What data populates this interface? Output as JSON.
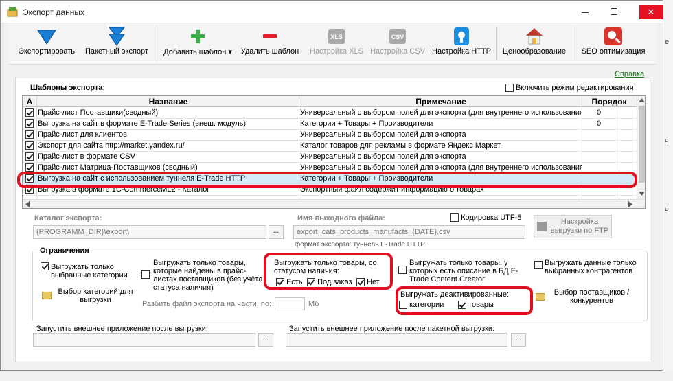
{
  "window": {
    "title": "Экспорт данных",
    "close_glyph": "✕"
  },
  "toolbar": {
    "export": "Экспортировать",
    "batch_export": "Пакетный экспорт",
    "add_template": "Добавить шаблон ▾",
    "delete_template": "Удалить шаблон",
    "xls_settings": "Настройка XLS",
    "csv_settings": "Настройка CSV",
    "http_settings": "Настройка HTTP",
    "pricing": "Ценообразование",
    "seo": "SEO оптимизация",
    "xls_badge": "XLS",
    "csv_badge": "CSV"
  },
  "help_link": "Справка",
  "templates": {
    "section_title": "Шаблоны экспорта:",
    "edit_mode_label": "Включить режим редактирования",
    "columns": {
      "a": "А",
      "name": "Название",
      "note": "Примечание",
      "order": "Порядок"
    },
    "rows": [
      {
        "checked": true,
        "name": "Прайс-лист Поставщики(сводный)",
        "note": "Универсальный с выбором полей для экспорта (для внутреннего использования)",
        "order": "0"
      },
      {
        "checked": true,
        "name": "Выгрузка на сайт в формате E-Trade Series (внеш. модуль)",
        "note": "Категории + Товары + Производители",
        "order": "0"
      },
      {
        "checked": true,
        "name": "Прайс-лист для клиентов",
        "note": "Универсальный с выбором полей для экспорта",
        "order": ""
      },
      {
        "checked": true,
        "name": "Экспорт для сайта http://market.yandex.ru/",
        "note": "Каталог товаров для рекламы в формате Яндекс Маркет",
        "order": ""
      },
      {
        "checked": true,
        "name": "Прайс-лист в формате CSV",
        "note": "Универсальный с выбором полей для экспорта",
        "order": ""
      },
      {
        "checked": true,
        "name": "Прайс-лист Матрица-Поставщиков (сводный)",
        "note": "Универсальный с выбором полей для экспорта (для внутреннего использования)",
        "order": ""
      },
      {
        "checked": true,
        "name": "Выгрузка на сайт с использованием туннеля E-Trade HTTP",
        "note": "Категории + Товары + Производители",
        "order": ""
      },
      {
        "checked": true,
        "name": "Выгрузка в формате 1С-CommerceML2 - Каталог",
        "note": "Экспортный файл содержит информацию о товарах",
        "order": ""
      }
    ]
  },
  "export_dir": {
    "label": "Каталог экспорта:",
    "value": "{PROGRAMM_DIR}\\export\\",
    "browse": "..."
  },
  "output_file": {
    "label": "Имя выходного файла:",
    "value": "export_cats_products_manufacts_{DATE}.csv",
    "format_note": "формат экспорта: туннель E-Trade HTTP",
    "utf8_label": "Кодировка UTF-8"
  },
  "ftp_button": "Настройка выгрузки по FTP",
  "limits": {
    "title": "Ограничения",
    "selected_categories": "Выгружать только выбранные категории",
    "choose_categories": "Выбор категорий для выгрузки",
    "supplier_goods": "Выгружать только товары, которые найдены в прайс-листах поставщиков (без учёта статуса наличия)",
    "split_label": "Разбить файл экспорта на части, по:",
    "split_unit": "Мб",
    "status_title": "Выгружать только товары, со статусом наличия:",
    "status_yes": "Есть",
    "status_order": "Под заказ",
    "status_no": "Нет",
    "with_description": "Выгружать только товары, у которых есть описание в БД E-Trade Content Creator",
    "deactivated_title": "Выгружать деактивированные:",
    "deact_categories": "категории",
    "deact_goods": "товары",
    "selected_contractors": "Выгружать данные только выбранных контрагентов",
    "choose_suppliers": "Выбор поставщиков / конкурентов"
  },
  "run_after": {
    "label": "Запустить внешнее приложение после выгрузки:",
    "browse": "..."
  },
  "run_after_batch": {
    "label": "Запустить внешнее приложение после пакетной выгрузки:",
    "browse": "..."
  }
}
